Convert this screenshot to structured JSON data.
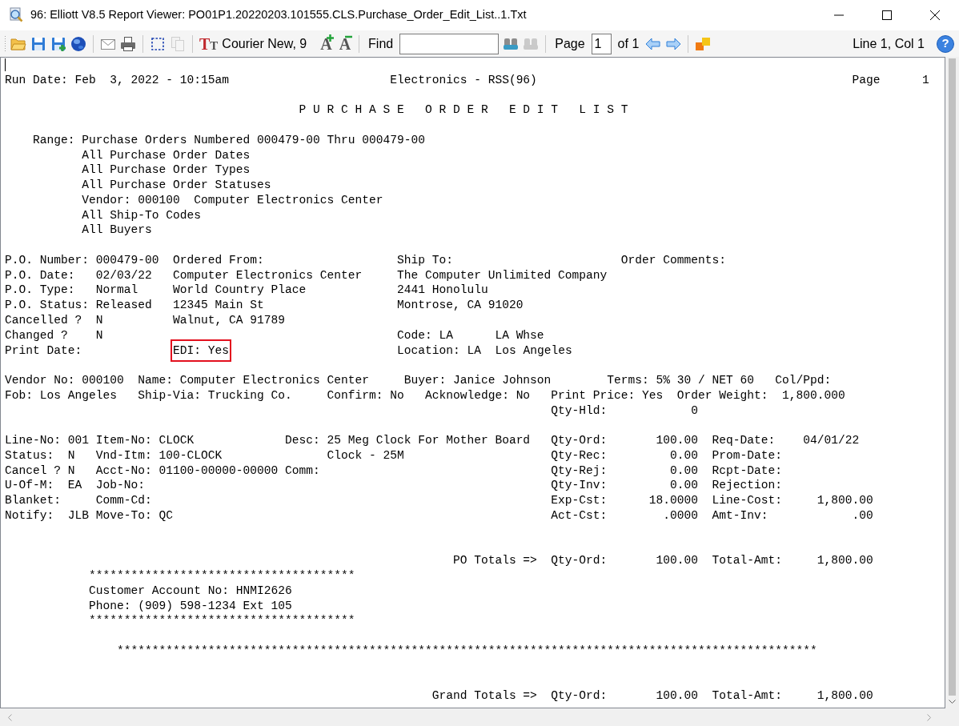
{
  "window": {
    "title": "96: Elliott V8.5 Report Viewer: PO01P1.20220203.101555.CLS.Purchase_Order_Edit_List..1.Txt"
  },
  "toolbar": {
    "items": [
      {
        "kind": "open",
        "disabled": false
      },
      {
        "kind": "save",
        "disabled": false
      },
      {
        "kind": "save-as",
        "disabled": false
      },
      {
        "kind": "web",
        "disabled": false
      },
      {
        "kind": "separator"
      },
      {
        "kind": "mail",
        "disabled": false
      },
      {
        "kind": "print",
        "disabled": false
      },
      {
        "kind": "separator"
      },
      {
        "kind": "select",
        "disabled": false
      },
      {
        "kind": "copy",
        "disabled": true
      },
      {
        "kind": "separator"
      },
      {
        "kind": "font",
        "glyphs": "TT",
        "label": "Courier New, 9"
      },
      {
        "kind": "grow",
        "glyph": "A",
        "disabled": false
      },
      {
        "kind": "shrink",
        "glyph": "A",
        "disabled": false
      },
      {
        "kind": "separator"
      },
      {
        "kind": "label",
        "text": "Find"
      },
      {
        "kind": "find-field"
      },
      {
        "kind": "find-next",
        "disabled": false
      },
      {
        "kind": "find-prev",
        "disabled": true
      },
      {
        "kind": "separator"
      },
      {
        "kind": "label",
        "text": "Page"
      },
      {
        "kind": "page-field",
        "value": "1"
      },
      {
        "kind": "label",
        "text": "of 1"
      },
      {
        "kind": "prev-page",
        "disabled": false
      },
      {
        "kind": "next-page",
        "disabled": false
      },
      {
        "kind": "separator"
      },
      {
        "kind": "export",
        "disabled": false
      }
    ],
    "position": "Line 1, Col 1",
    "help_glyph": "?"
  },
  "report": {
    "lines": [
      {
        "kind": "text",
        "text": "Run Date: Feb  3, 2022 - 10:15am                       Electronics - RSS(96)                                             Page      1"
      },
      {
        "kind": "blank"
      },
      {
        "kind": "text",
        "text": "                                          P U R C H A S E   O R D E R   E D I T   L I S T"
      },
      {
        "kind": "blank"
      },
      {
        "kind": "text",
        "text": "    Range: Purchase Orders Numbered 000479-00 Thru 000479-00"
      },
      {
        "kind": "text",
        "text": "           All Purchase Order Dates"
      },
      {
        "kind": "text",
        "text": "           All Purchase Order Types"
      },
      {
        "kind": "text",
        "text": "           All Purchase Order Statuses"
      },
      {
        "kind": "text",
        "text": "           Vendor: 000100  Computer Electronics Center"
      },
      {
        "kind": "text",
        "text": "           All Ship-To Codes"
      },
      {
        "kind": "text",
        "text": "           All Buyers"
      },
      {
        "kind": "blank"
      },
      {
        "kind": "text",
        "text": "P.O. Number: 000479-00  Ordered From:                   Ship To:                        Order Comments:"
      },
      {
        "kind": "text",
        "text": "P.O. Date:   02/03/22   Computer Electronics Center     The Computer Unlimited Company"
      },
      {
        "kind": "text",
        "text": "P.O. Type:   Normal     World Country Place             2441 Honolulu"
      },
      {
        "kind": "text",
        "text": "P.O. Status: Released   12345 Main St                   Montrose, CA 91020"
      },
      {
        "kind": "text",
        "text": "Cancelled ?  N          Walnut, CA 91789"
      },
      {
        "kind": "text",
        "text": "Changed ?    N                                          Code: LA      LA Whse"
      },
      {
        "kind": "marked",
        "segments": [
          {
            "text": "Print Date:             ",
            "highlighted": false
          },
          {
            "text": "EDI: Yes",
            "highlighted": true
          },
          {
            "text": "                        Location: LA  Los Angeles",
            "highlighted": false
          }
        ]
      },
      {
        "kind": "blank"
      },
      {
        "kind": "text",
        "text": "Vendor No: 000100  Name: Computer Electronics Center     Buyer: Janice Johnson        Terms: 5% 30 / NET 60   Col/Ppd:"
      },
      {
        "kind": "text",
        "text": "Fob: Los Angeles   Ship-Via: Trucking Co.     Confirm: No   Acknowledge: No   Print Price: Yes  Order Weight:  1,800.000"
      },
      {
        "kind": "text",
        "text": "                                                                              Qty-Hld:            0"
      },
      {
        "kind": "blank"
      },
      {
        "kind": "text",
        "text": "Line-No: 001 Item-No: CLOCK             Desc: 25 Meg Clock For Mother Board   Qty-Ord:       100.00  Req-Date:    04/01/22"
      },
      {
        "kind": "text",
        "text": "Status:  N   Vnd-Itm: 100-CLOCK               Clock - 25M                     Qty-Rec:         0.00  Prom-Date:"
      },
      {
        "kind": "text",
        "text": "Cancel ? N   Acct-No: 01100-00000-00000 Comm:                                 Qty-Rej:         0.00  Rcpt-Date:"
      },
      {
        "kind": "text",
        "text": "U-Of-M:  EA  Job-No:                                                          Qty-Inv:         0.00  Rejection:"
      },
      {
        "kind": "text",
        "text": "Blanket:     Comm-Cd:                                                         Exp-Cst:      18.0000  Line-Cost:     1,800.00"
      },
      {
        "kind": "text",
        "text": "Notify:  JLB Move-To: QC                                                      Act-Cst:        .0000  Amt-Inv:            .00"
      },
      {
        "kind": "blank"
      },
      {
        "kind": "blank"
      },
      {
        "kind": "text",
        "text": "                                                                PO Totals =>  Qty-Ord:       100.00  Total-Amt:     1,800.00"
      },
      {
        "kind": "text",
        "text": "            **************************************"
      },
      {
        "kind": "text",
        "text": "            Customer Account No: HNMI2626"
      },
      {
        "kind": "text",
        "text": "            Phone: (909) 598-1234 Ext 105"
      },
      {
        "kind": "text",
        "text": "            **************************************"
      },
      {
        "kind": "blank"
      },
      {
        "kind": "text",
        "text": "                ****************************************************************************************************"
      },
      {
        "kind": "blank"
      },
      {
        "kind": "blank"
      },
      {
        "kind": "text",
        "text": "                                                             Grand Totals =>  Qty-Ord:       100.00  Total-Amt:     1,800.00"
      }
    ]
  }
}
